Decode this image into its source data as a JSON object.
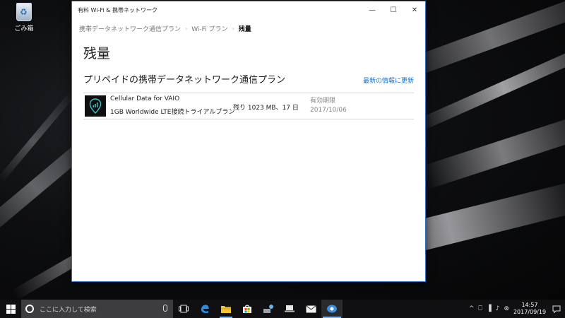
{
  "desktop": {
    "recycle_bin_label": "ごみ箱"
  },
  "window": {
    "title": "有料 Wi-Fi & 携帯ネットワーク",
    "controls": {
      "minimize": "—",
      "maximize": "☐",
      "close": "✕"
    },
    "breadcrumb": [
      {
        "label": "携帯データネットワーク通信プラン"
      },
      {
        "label": "Wi-Fi プラン"
      },
      {
        "label": "残量"
      }
    ],
    "page_title": "残量",
    "section_title": "プリペイドの携帯データネットワーク通信プラン",
    "refresh_link": "最新の情報に更新",
    "plan": {
      "name": "Cellular Data for VAIO",
      "description": "1GB Worldwide LTE接続トライアルプラン",
      "remaining": "残り 1023 MB、17 日",
      "expiry_label": "有効期限",
      "expiry_date": "2017/10/06"
    }
  },
  "taskbar": {
    "search_placeholder": "ここに入力して検索",
    "pinned": [
      {
        "name": "task-view-icon"
      },
      {
        "name": "edge-icon"
      },
      {
        "name": "file-explorer-icon"
      },
      {
        "name": "store-icon"
      },
      {
        "name": "network-app-icon"
      },
      {
        "name": "laptop-icon"
      },
      {
        "name": "mail-icon"
      },
      {
        "name": "data-plan-icon"
      }
    ],
    "tray": {
      "chevron": "^",
      "network": "⎕",
      "signal": "▐",
      "volume": "♪",
      "ime": "⊗"
    },
    "clock_time": "14:57",
    "clock_date": "2017/09/19"
  },
  "colors": {
    "accent": "#1a73c7",
    "window_border": "#2c6fc7",
    "taskbar": "#101012"
  }
}
